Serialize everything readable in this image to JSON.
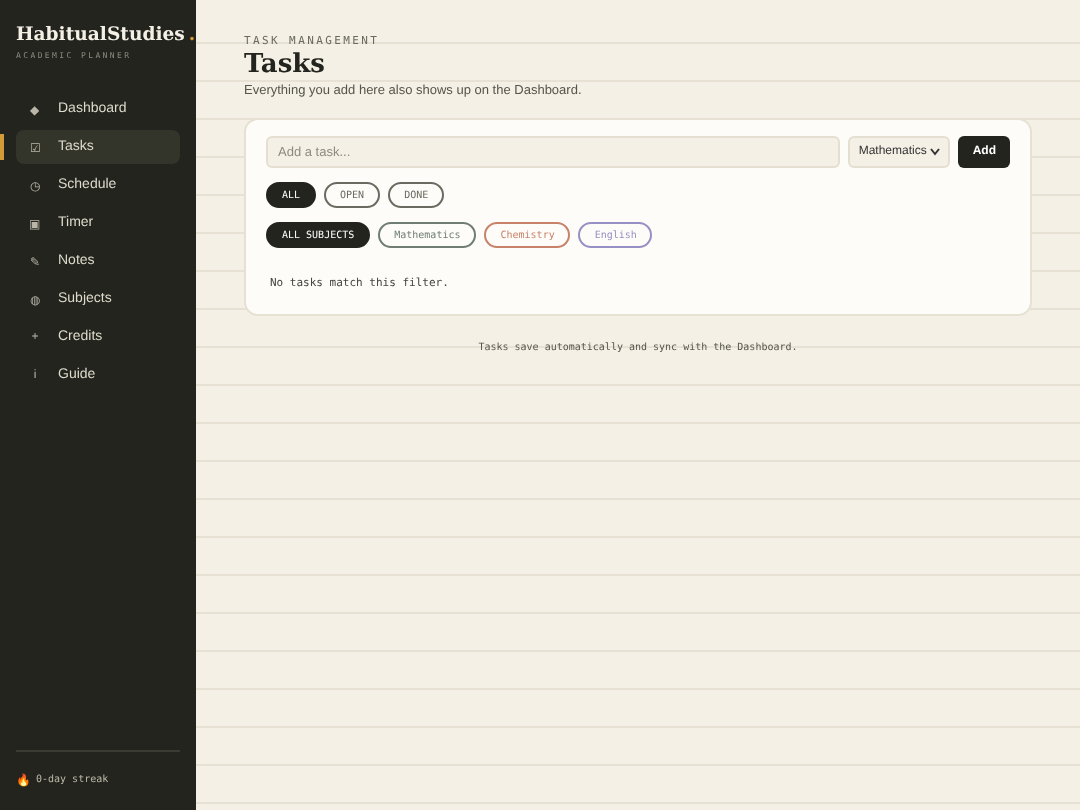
{
  "brand": {
    "name": "HabitualStudies",
    "dot": ".",
    "subtitle": "ACADEMIC PLANNER"
  },
  "nav": [
    {
      "icon": "◆",
      "label": "Dashboard",
      "selected": false
    },
    {
      "icon": "☑",
      "label": "Tasks",
      "selected": true
    },
    {
      "icon": "◷",
      "label": "Schedule",
      "selected": false
    },
    {
      "icon": "▣",
      "label": "Timer",
      "selected": false
    },
    {
      "icon": "✎",
      "label": "Notes",
      "selected": false
    },
    {
      "icon": "◍",
      "label": "Subjects",
      "selected": false
    },
    {
      "icon": "+",
      "label": "Credits",
      "selected": false
    },
    {
      "icon": "i",
      "label": "Guide",
      "selected": false
    }
  ],
  "streak": {
    "icon": "🔥",
    "text": "0-day streak"
  },
  "header": {
    "eyebrow": "TASK MANAGEMENT",
    "title": "Tasks",
    "subtitle": "Everything you add here also shows up on the Dashboard."
  },
  "composer": {
    "placeholder": "Add a task...",
    "subject": "Mathematics",
    "button": "Add"
  },
  "status_filters": [
    {
      "label": "ALL",
      "selected": true
    },
    {
      "label": "OPEN",
      "selected": false
    },
    {
      "label": "DONE",
      "selected": false
    }
  ],
  "subject_filters": [
    {
      "label": "ALL SUBJECTS",
      "selected": true,
      "color": "#23241e"
    },
    {
      "label": "Mathematics",
      "selected": false,
      "color": "#6f7d72"
    },
    {
      "label": "Chemistry",
      "selected": false,
      "color": "#c8826a"
    },
    {
      "label": "English",
      "selected": false,
      "color": "#9690c4"
    }
  ],
  "empty_message": "No tasks match this filter.",
  "footer": "Tasks save automatically and sync with the Dashboard."
}
